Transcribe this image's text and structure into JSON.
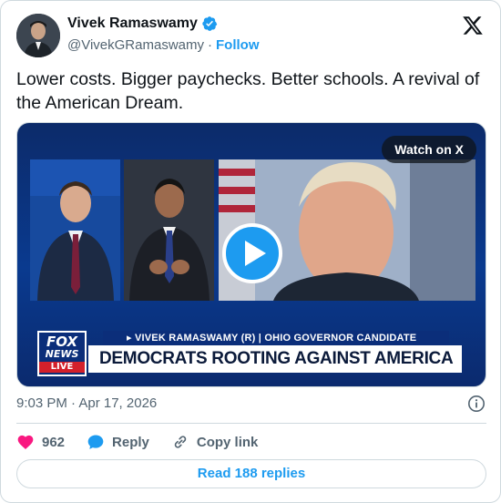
{
  "author": {
    "display_name": "Vivek Ramaswamy",
    "handle": "@VivekGRamaswamy",
    "follow_label": "Follow",
    "verified": true
  },
  "tweet": {
    "text": "Lower costs. Bigger paychecks. Better schools. A revival of the American Dream."
  },
  "media": {
    "watch_label": "Watch on X",
    "chyron_top": "▸ VIVEK RAMASWAMY (R) | OHIO GOVERNOR CANDIDATE",
    "chyron_main": "DEMOCRATS ROOTING AGAINST AMERICA",
    "logo_fox": "FOX",
    "logo_news": "NEWS",
    "logo_live": "LIVE"
  },
  "meta": {
    "timestamp": "9:03 PM · Apr 17, 2026"
  },
  "actions": {
    "likes": "962",
    "reply_label": "Reply",
    "copy_label": "Copy link"
  },
  "footer": {
    "read_replies": "Read 188 replies"
  },
  "colors": {
    "accent": "#1d9bf0",
    "like": "#f91880",
    "text": "#0f1419",
    "muted": "#536471"
  }
}
